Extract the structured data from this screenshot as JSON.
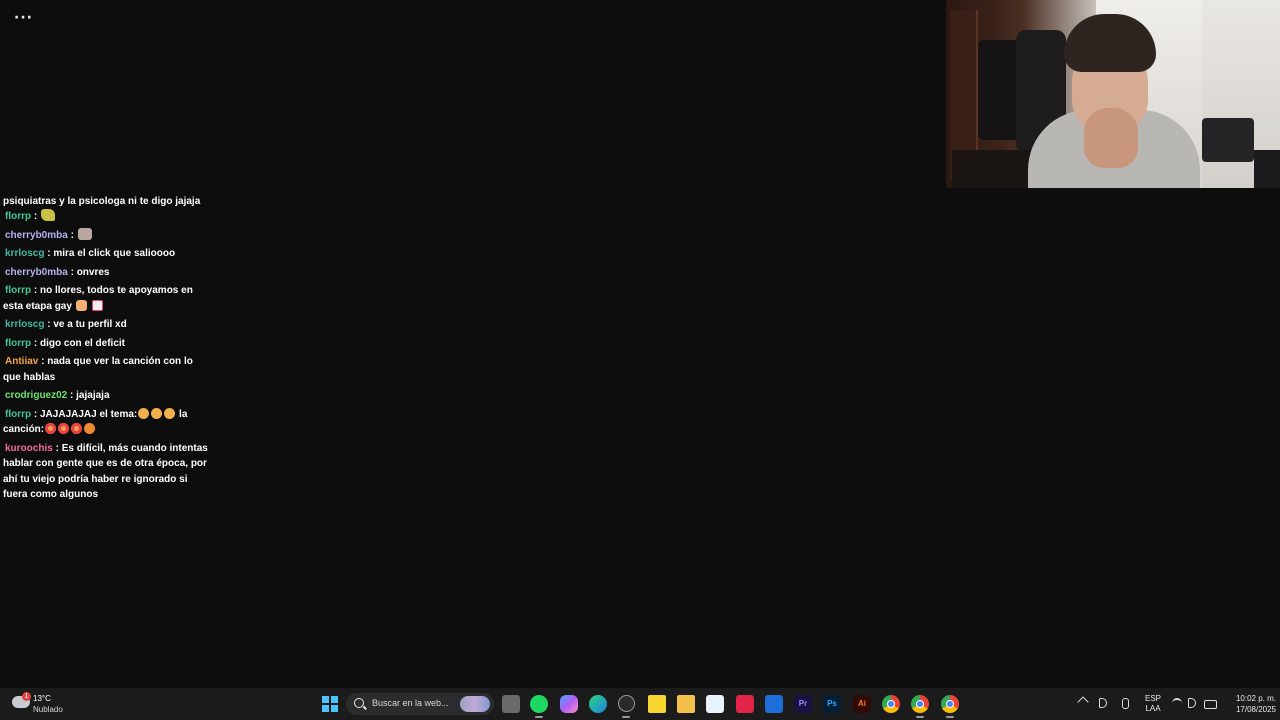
{
  "overlay": {
    "menu_icon": "more-horizontal-icon",
    "menu_glyph": "···"
  },
  "chat": {
    "cut_line": "psiquiatras y la psicologa ni te digo jajaja",
    "messages": [
      {
        "user": "florrp",
        "color": "#43c795",
        "text": "",
        "emotes": [
          "dino-emote"
        ]
      },
      {
        "user": "cherryb0mba",
        "color": "#b7b2f0",
        "text": "",
        "emotes": [
          "cat-emote"
        ]
      },
      {
        "user": "krrloscg",
        "color": "#3fb9a3",
        "text": "mira el click que salioooo"
      },
      {
        "user": "cherryb0mba",
        "color": "#b7b2f0",
        "text": "onvres"
      },
      {
        "user": "florrp",
        "color": "#43c795",
        "text": "no llores, todos te apoyamos en esta etapa gay"
      },
      {
        "user": "krrloscg",
        "color": "#3fb9a3",
        "text": "ve a tu perfil xd"
      },
      {
        "user": "florrp",
        "color": "#43c795",
        "text": "digo con el deficit"
      },
      {
        "user": "Antiiav",
        "color": "#f2a64a",
        "text": "nada que ver la canción con lo que hablas"
      },
      {
        "user": "crodriguez02",
        "color": "#6ee36f",
        "text": "jajajaja"
      },
      {
        "user": "florrp",
        "color": "#43c795",
        "text_a": "JAJAJAJAJ el tema:",
        "text_b": "la canción:"
      },
      {
        "user": "kuroochis",
        "color": "#f06a9b",
        "text": "Es difícil, más cuando intentas hablar con gente que es de otra época, por ahí tu viejo podría haber re ignorado si fuera como algunos"
      }
    ]
  },
  "taskbar": {
    "weather": {
      "temp": "13°C",
      "condition": "Nublado",
      "badge": "1",
      "icon": "cloudy-weather-icon"
    },
    "search": {
      "placeholder": "Buscar en la web..."
    },
    "apps": {
      "premiere": "Pr",
      "photoshop": "Ps",
      "illustrator": "Ai"
    },
    "tray": {
      "lang_1": "ESP",
      "lang_2": "LAA",
      "time": "10:02 p. m.",
      "date": "17/08/2025"
    }
  }
}
